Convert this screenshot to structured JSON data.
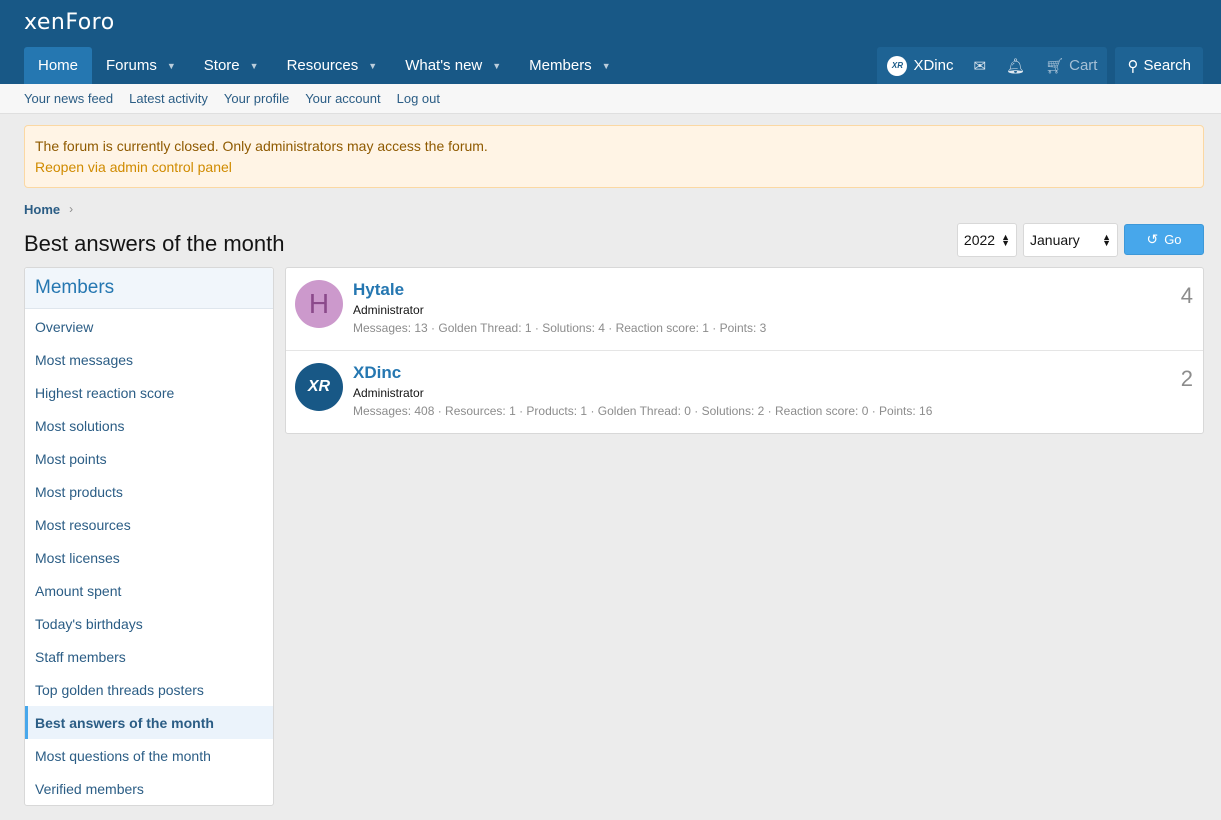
{
  "header": {
    "logo_main": "xenForo",
    "nav": [
      {
        "label": "Home"
      },
      {
        "label": "Forums"
      },
      {
        "label": "Store"
      },
      {
        "label": "Resources"
      },
      {
        "label": "What's new"
      },
      {
        "label": "Members"
      }
    ],
    "user": {
      "avatar_text": "XR",
      "name": "XDinc"
    },
    "cart_label": "Cart",
    "search_label": "Search"
  },
  "subnav": [
    "Your news feed",
    "Latest activity",
    "Your profile",
    "Your account",
    "Log out"
  ],
  "notice": {
    "message": "The forum is currently closed. Only administrators may access the forum.",
    "link": "Reopen via admin control panel"
  },
  "breadcrumb": {
    "home": "Home"
  },
  "page_title": "Best answers of the month",
  "filter": {
    "year": "2022",
    "month": "January",
    "go_label": "Go"
  },
  "sidebar": {
    "heading": "Members",
    "items": [
      "Overview",
      "Most messages",
      "Highest reaction score",
      "Most solutions",
      "Most points",
      "Most products",
      "Most resources",
      "Most licenses",
      "Amount spent",
      "Today's birthdays",
      "Staff members",
      "Top golden threads posters",
      "Best answers of the month",
      "Most questions of the month",
      "Verified members"
    ],
    "selected": "Best answers of the month"
  },
  "members": [
    {
      "avatar_letter": "H",
      "name": "Hytale",
      "title": "Administrator",
      "stats": "Messages: 13 · Golden Thread: 1 · Solutions: 4 · Reaction score: 1 · Points: 3",
      "count": "4"
    },
    {
      "avatar_letter": "XR",
      "name": "XDinc",
      "title": "Administrator",
      "stats": "Messages: 408 · Resources: 1 · Products: 1 · Golden Thread: 0 · Solutions: 2 · Reaction score: 0 · Points: 16",
      "count": "2"
    }
  ],
  "colors": {
    "header_bg": "#185886",
    "nav_active": "#2577b1",
    "notice_bg": "#fff4e5",
    "link": "#2b5d85",
    "button": "#47a7eb"
  }
}
